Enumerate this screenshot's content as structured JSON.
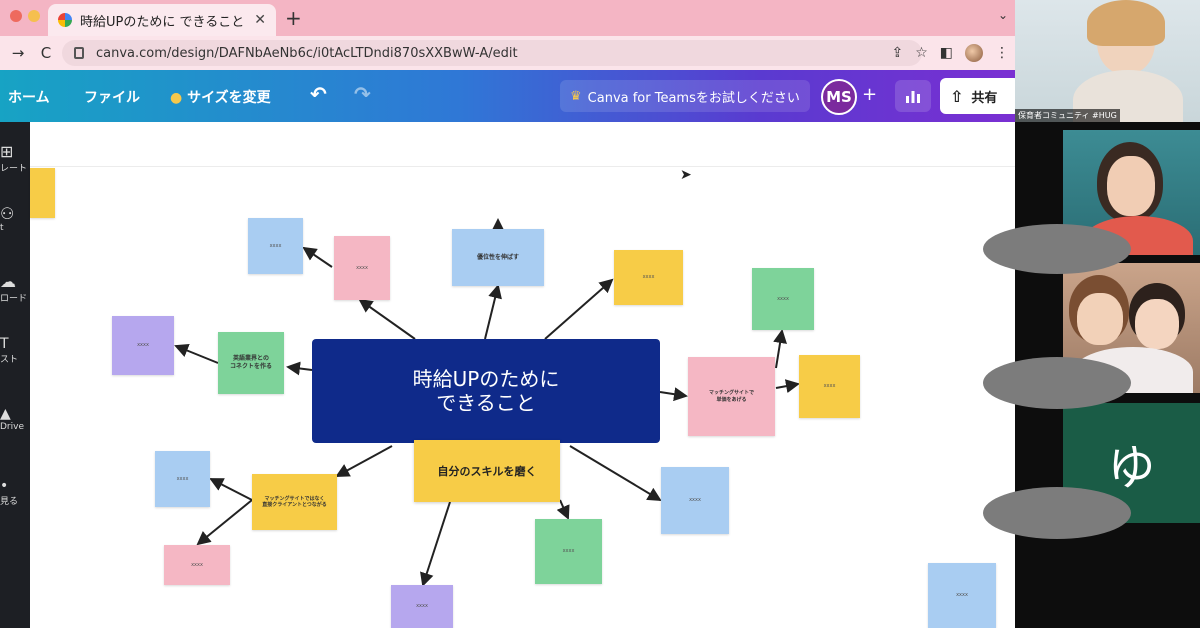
{
  "browser": {
    "tab_title": "時給UPのために できること - ホワ",
    "tab_close": "✕",
    "new_tab": "+",
    "tab_menu": "⌄",
    "url": "canva.com/design/DAFNbAeNb6c/i0tAcLTDndi870sXXBwW-A/edit",
    "back": "→",
    "reload": "C",
    "share_icon": "⇪",
    "bookmark_icon": "☆",
    "sidebar_icon": "◧",
    "menu_icon": "⋮",
    "window_colors": [
      "#ee6a5e",
      "#f5bf4f",
      "#61c554"
    ]
  },
  "toolbar": {
    "home": "ホーム",
    "file": "ファイル",
    "resize": "サイズを変更",
    "resize_icon": "●",
    "undo": "↶",
    "redo": "↷",
    "teams_icon": "♛",
    "teams": "Canva for Teamsをお試しください",
    "avatar": "MS",
    "add": "+",
    "share_icon": "⇧",
    "share": "共有"
  },
  "sidebar": {
    "items": [
      {
        "icon": "⊞",
        "label": "レート"
      },
      {
        "icon": "⚇",
        "label": "t"
      },
      {
        "icon": "☁",
        "label": "ロード"
      },
      {
        "icon": "T",
        "label": "スト"
      },
      {
        "icon": "▲",
        "label": "Drive"
      },
      {
        "icon": "•",
        "label": "見る"
      }
    ]
  },
  "mindmap": {
    "center": "時給UPのために\nできること",
    "skill": "自分のスキルを磨く",
    "notes": {
      "top_center": "優位性を伸ばす",
      "left_green": "英語業界との\nコネクトを作る",
      "right_pink": "マッチングサイトで\n単価をあげる",
      "bottom_left_yellow": "マッチングサイトではなく\n直接クライアントとつながる",
      "small": "xxxx"
    },
    "colors": {
      "blue": "#a9cdf2",
      "pink": "#f5b7c4",
      "yellow": "#f7cc47",
      "green": "#7ed39a",
      "purple": "#b6a7ee",
      "navy": "#0f2a8a"
    }
  },
  "video": {
    "top_label": "保育者コミュニティ #HUG",
    "yu_initial": "ゆ"
  }
}
